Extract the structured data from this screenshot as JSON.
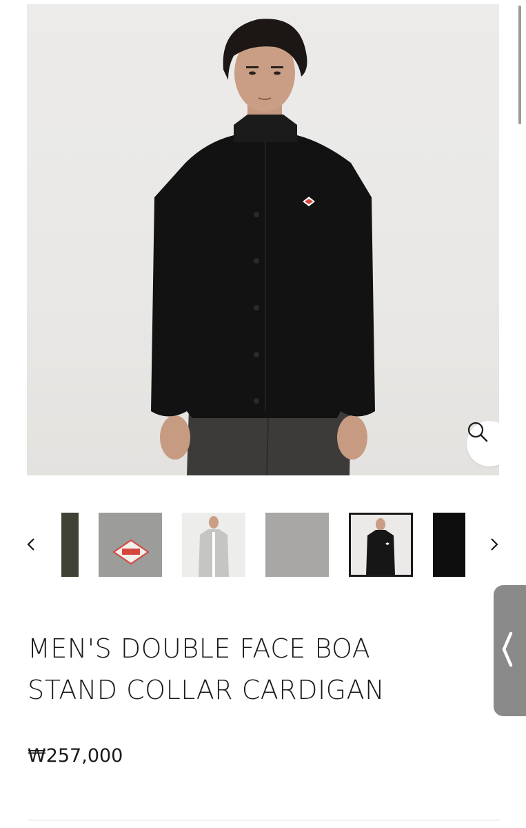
{
  "gallery": {
    "main_image_alt": "Model wearing black boa stand collar cardigan",
    "zoom_icon": "magnifier-icon",
    "prev_icon": "chevron-left-icon",
    "next_icon": "chevron-right-icon",
    "thumbnails": [
      {
        "name": "thumb-olive-fabric",
        "color": "#3f4234"
      },
      {
        "name": "thumb-logo-closeup",
        "color": "#9c9c9a"
      },
      {
        "name": "thumb-gray-cardigan-model",
        "color": "#c5c5c3"
      },
      {
        "name": "thumb-gray-fabric",
        "color": "#a8a7a5"
      },
      {
        "name": "thumb-black-cardigan-model",
        "color": "#161616",
        "selected": true
      },
      {
        "name": "thumb-black-fabric",
        "color": "#0e0e0e"
      }
    ]
  },
  "product": {
    "title_line1": "MEN'S DOUBLE FACE BOA",
    "title_line2": "STAND COLLAR CARDIGAN",
    "price": "₩257,000"
  },
  "side_handle": {
    "icon": "chevron-left-icon"
  },
  "colors": {
    "accent_logo": "#d6463f",
    "text": "#1a1a1a",
    "thumb_border": "#1a1a1a"
  }
}
